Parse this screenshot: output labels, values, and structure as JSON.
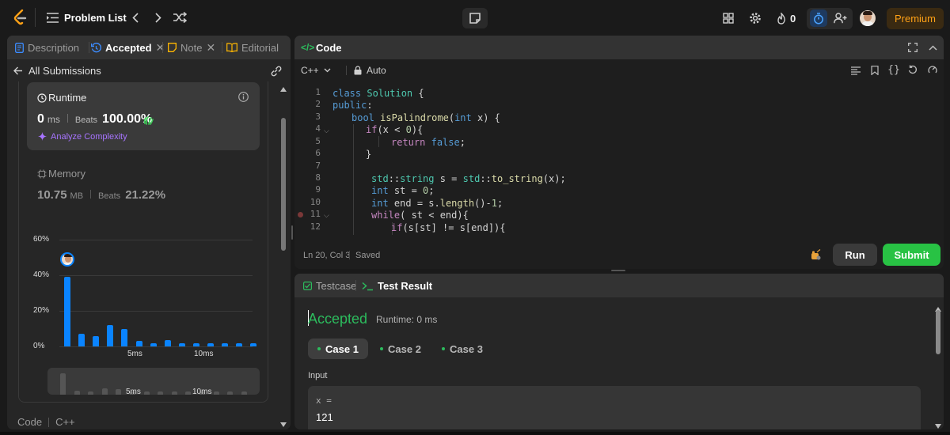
{
  "nav": {
    "title": "Problem List",
    "streak": "0",
    "premium": "Premium"
  },
  "left": {
    "tabs": [
      {
        "label": "Description"
      },
      {
        "label": "Accepted"
      },
      {
        "label": "Note"
      },
      {
        "label": "Editorial"
      }
    ],
    "back_label": "All Submissions",
    "runtime": {
      "label": "Runtime",
      "value": "0",
      "unit": "ms",
      "beats_label": "Beats",
      "beats": "100.00%",
      "analyze": "Analyze Complexity"
    },
    "memory": {
      "label": "Memory",
      "value": "10.75",
      "unit": "MB",
      "beats_label": "Beats",
      "beats": "21.22%"
    },
    "footer": {
      "code": "Code",
      "lang": "C++"
    }
  },
  "chart_data": {
    "type": "bar",
    "ylabels": [
      "60%",
      "40%",
      "20%",
      "0%"
    ],
    "xlabels": [
      "5ms",
      "10ms"
    ],
    "values": [
      39,
      7,
      6,
      12,
      10,
      3,
      2,
      3.5,
      2,
      2,
      2,
      2,
      2,
      2
    ],
    "ylim": [
      0,
      60
    ],
    "color": "#0a84ff"
  },
  "mini_chart": {
    "xlabels": [
      "5ms",
      "10ms"
    ]
  },
  "code": {
    "title": "Code",
    "lang": "C++",
    "mode": "Auto",
    "line_numbers": [
      "1",
      "2",
      "3",
      "4",
      "5",
      "6",
      "7",
      "8",
      "9",
      "10",
      "11",
      "12"
    ],
    "status_pos": "Ln 20, Col 3",
    "status_saved": "Saved",
    "run": "Run",
    "submit": "Submit"
  },
  "result": {
    "tab_testcase": "Testcase",
    "tab_result": "Test Result",
    "verdict": "Accepted",
    "runtime": "Runtime: 0 ms",
    "cases": [
      "Case 1",
      "Case 2",
      "Case 3"
    ],
    "input_label": "Input",
    "var_name": "x =",
    "var_value": "121"
  },
  "colors": {
    "accent_green": "#2cbb5d",
    "accent_blue": "#0a84ff",
    "premium": "#ffa116"
  }
}
